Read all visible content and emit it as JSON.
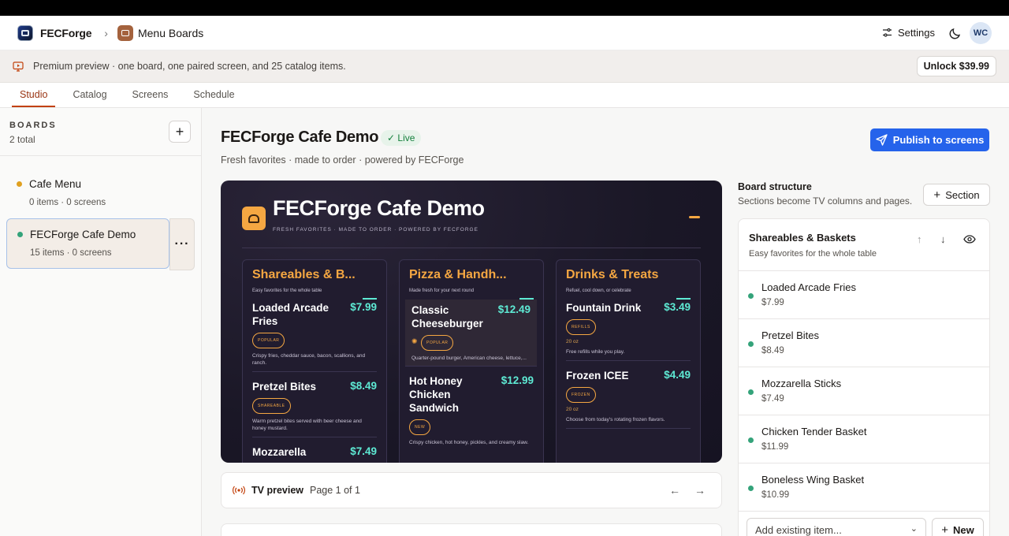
{
  "header": {
    "brand": "FECForge",
    "crumb": "Menu Boards",
    "settings_label": "Settings",
    "avatar_initials": "WC"
  },
  "banner": {
    "text": "Premium preview · one board, one paired screen, and 25 catalog items.",
    "unlock_label": "Unlock $39.99"
  },
  "tabs": [
    "Studio",
    "Catalog",
    "Screens",
    "Schedule"
  ],
  "sidebar": {
    "title": "BOARDS",
    "count": "2 total",
    "boards": [
      {
        "name": "Cafe Menu",
        "meta": "0 items · 0 screens",
        "dot_color": "#e0a020"
      },
      {
        "name": "FECForge Cafe Demo",
        "meta": "15 items · 0 screens",
        "dot_color": "#34a37a"
      }
    ]
  },
  "board": {
    "title": "FECForge Cafe Demo",
    "status": "Live",
    "subtitle": "Fresh favorites · made to order · powered by FECForge",
    "publish_label": "Publish to screens"
  },
  "tv": {
    "title": "FECForge Cafe Demo",
    "subtitle": "FRESH FAVORITES · MADE TO ORDER · POWERED BY FECFORGE",
    "columns": [
      {
        "heading": "Shareables & B...",
        "desc": "Easy favorites for the whole table",
        "items": [
          {
            "name": "Loaded Arcade Fries",
            "price": "$7.99",
            "tag": "POPULAR",
            "desc": "Crispy fries, cheddar sauce, bacon, scallions, and ranch."
          },
          {
            "name": "Pretzel Bites",
            "price": "$8.49",
            "tag": "SHAREABLE",
            "desc": "Warm pretzel bites served with beer cheese and honey mustard."
          },
          {
            "name": "Mozzarella",
            "price": "$7.49"
          }
        ]
      },
      {
        "heading": "Pizza & Handh...",
        "desc": "Made fresh for your next round",
        "items": [
          {
            "name": "Classic Cheeseburger",
            "price": "$12.49",
            "tag": "POPULAR",
            "desc": "Quarter-pound burger, American cheese, lettuce,..."
          },
          {
            "name": "Hot Honey Chicken Sandwich",
            "price": "$12.99",
            "tag": "NEW",
            "desc": "Crispy chicken, hot honey, pickles, and creamy slaw."
          }
        ]
      },
      {
        "heading": "Drinks & Treats",
        "desc": "Refuel, cool down, or celebrate",
        "items": [
          {
            "name": "Fountain Drink",
            "price": "$3.49",
            "tag": "REFILLS",
            "size": "20 oz",
            "desc": "Free refills while you play."
          },
          {
            "name": "Frozen ICEE",
            "price": "$4.49",
            "tag": "FROZEN",
            "size": "20 oz",
            "desc": "Choose from today's rotating frozen flavors."
          }
        ]
      }
    ]
  },
  "preview": {
    "label": "TV preview",
    "page": "Page 1 of 1"
  },
  "structure": {
    "title": "Board structure",
    "desc": "Sections become TV columns and pages.",
    "section_btn": "Section",
    "section": {
      "name": "Shareables & Baskets",
      "desc": "Easy favorites for the whole table",
      "items": [
        {
          "name": "Loaded Arcade Fries",
          "price": "$7.99"
        },
        {
          "name": "Pretzel Bites",
          "price": "$8.49"
        },
        {
          "name": "Mozzarella Sticks",
          "price": "$7.49"
        },
        {
          "name": "Chicken Tender Basket",
          "price": "$11.99"
        },
        {
          "name": "Boneless Wing Basket",
          "price": "$10.99"
        }
      ]
    },
    "add_placeholder": "Add existing item...",
    "new_label": "New"
  },
  "colors": {
    "accent": "#2563eb",
    "brand_orange": "#f5a742",
    "price_teal": "#5eead4",
    "active_tab": "#c2410c"
  }
}
